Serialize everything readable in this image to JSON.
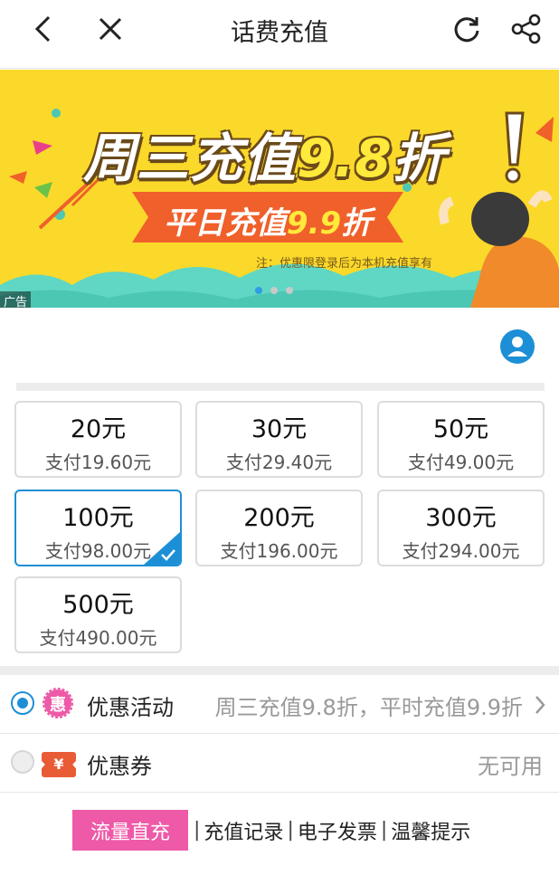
{
  "header": {
    "title": "话费充值",
    "back_icon": "chevron-left-icon",
    "close_icon": "close-icon",
    "refresh_icon": "refresh-icon",
    "share_icon": "share-icon"
  },
  "banner": {
    "headline_prefix": "周三充值",
    "headline_discount": "9.8",
    "headline_suffix": "折",
    "subline_prefix": "平日充值",
    "subline_discount": "9.9",
    "subline_suffix": "折",
    "note": "注：优惠限登录后为本机充值享有",
    "ad_label": "广告",
    "slides_total": 3,
    "slide_active": 1,
    "colors": {
      "background": "#fbd92a",
      "ribbon": "#f0602a"
    }
  },
  "account_icon": "user-circle-icon",
  "amounts": [
    {
      "amount": "20元",
      "pay": "支付19.60元",
      "selected": false
    },
    {
      "amount": "30元",
      "pay": "支付29.40元",
      "selected": false
    },
    {
      "amount": "50元",
      "pay": "支付49.00元",
      "selected": false
    },
    {
      "amount": "100元",
      "pay": "支付98.00元",
      "selected": true
    },
    {
      "amount": "200元",
      "pay": "支付196.00元",
      "selected": false
    },
    {
      "amount": "300元",
      "pay": "支付294.00元",
      "selected": false
    },
    {
      "amount": "500元",
      "pay": "支付490.00元",
      "selected": false
    }
  ],
  "promotion": {
    "badge": "惠",
    "label": "优惠活动",
    "value": "周三充值9.8折，平时充值9.9折",
    "selected": true
  },
  "coupon": {
    "badge": "¥",
    "label": "优惠券",
    "value": "无可用",
    "selected": false
  },
  "footer": {
    "flow_button": "流量直充",
    "links": [
      "充值记录",
      "电子发票",
      "温馨提示"
    ],
    "separator": "|"
  },
  "colors": {
    "accent": "#1d8fd6",
    "pink": "#ee5aa7",
    "coupon": "#e95b35"
  }
}
